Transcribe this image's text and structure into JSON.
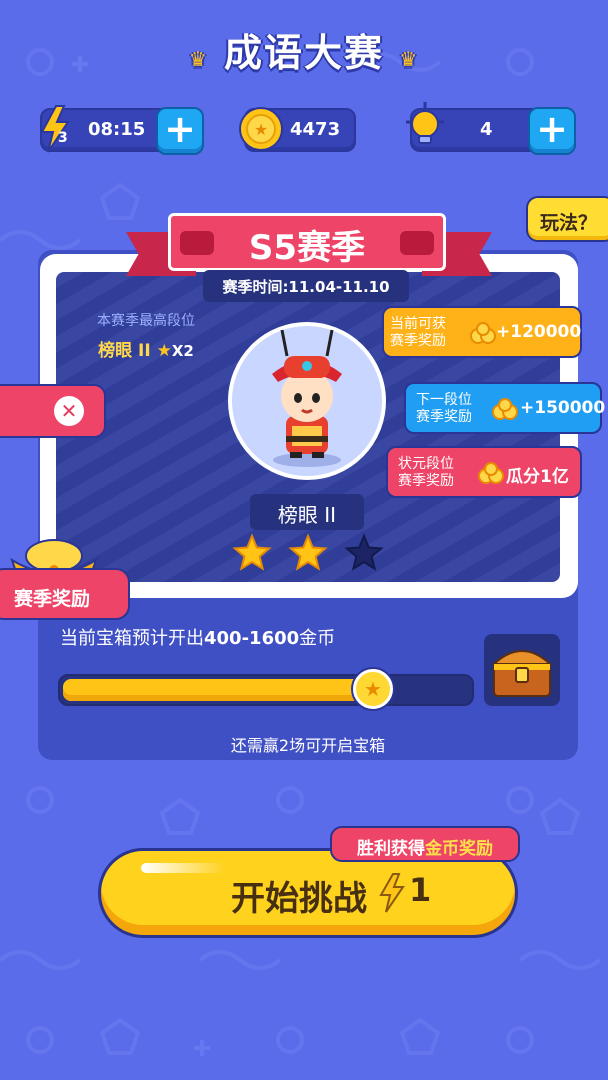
{
  "title": "成语大赛",
  "stats": {
    "energy_count": "3",
    "energy_timer": "08:15",
    "coins": "4473",
    "hints": "4"
  },
  "howto_label": "玩法？",
  "season": {
    "title": "S5赛季",
    "time": "赛季时间:11.04-11.10",
    "best_label": "本赛季最高段位",
    "best_rank": "榜眼 II",
    "best_multiplier": "X2",
    "current_rank": "榜眼 II",
    "stars_earned": 2,
    "stars_total": 3
  },
  "rewards": [
    {
      "label_line1": "当前可获",
      "label_line2": "赛季奖励",
      "value": "+120000",
      "color": "#ffb218"
    },
    {
      "label_line1": "下一段位",
      "label_line2": "赛季奖励",
      "value": "+150000",
      "color": "#1f9ef3"
    },
    {
      "label_line1": "状元段位",
      "label_line2": "赛季奖励",
      "value": "瓜分1亿",
      "color": "#ee4468"
    }
  ],
  "season_reward_tab": "赛季奖励",
  "chest": {
    "text_prefix": "当前宝箱预计开出",
    "range": "400-1600",
    "text_suffix": "金币",
    "progress": 0.78,
    "wins_needed": "还需赢2场可开启宝箱"
  },
  "start": {
    "label": "开始挑战",
    "cost": "1",
    "tag_prefix": "胜利获得",
    "tag_highlight": "金币奖励"
  },
  "colors": {
    "background": "#5a6cea",
    "accent_yellow": "#ffd21e",
    "accent_pink": "#ee4468",
    "accent_blue": "#1fa7f4"
  },
  "icons": [
    "lightning-icon",
    "plus-icon",
    "coin-icon",
    "lightbulb-icon",
    "crossed-swords-icon",
    "star-icon",
    "treasure-chest-icon",
    "gold-ingot-icon"
  ]
}
